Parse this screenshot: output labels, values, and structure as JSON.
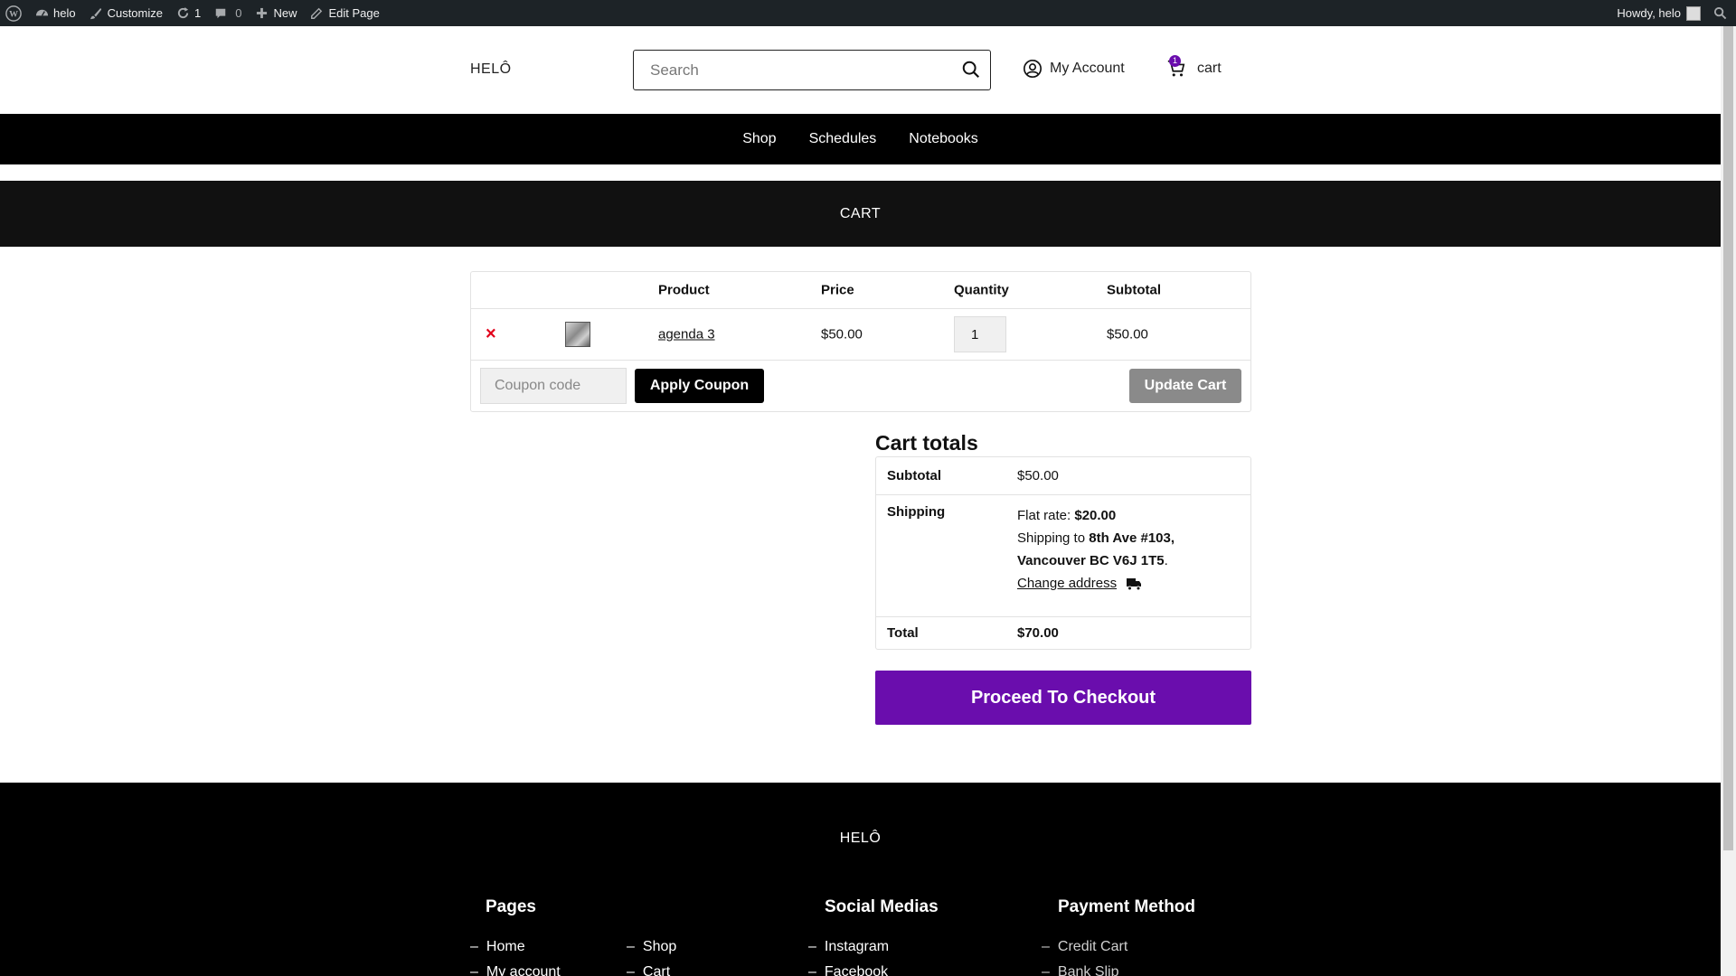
{
  "adminbar": {
    "site_name": "helo",
    "customize": "Customize",
    "updates_count": "1",
    "comments_count": "0",
    "new": "New",
    "edit_page": "Edit Page",
    "howdy": "Howdy, helo"
  },
  "header": {
    "logo": "HELÔ",
    "search_placeholder": "Search",
    "account": "My Account",
    "cart": "cart",
    "cart_count": "1"
  },
  "nav": [
    "Shop",
    "Schedules",
    "Notebooks"
  ],
  "page_title": "CART",
  "cart": {
    "columns": {
      "product": "Product",
      "price": "Price",
      "quantity": "Quantity",
      "subtotal": "Subtotal"
    },
    "items": [
      {
        "remove": "×",
        "name": "agenda 3",
        "price": "$50.00",
        "quantity": "1",
        "subtotal": "$50.00"
      }
    ],
    "coupon_placeholder": "Coupon code",
    "apply_coupon": "Apply Coupon",
    "update_cart": "Update Cart"
  },
  "totals": {
    "title": "Cart totals",
    "subtotal_label": "Subtotal",
    "subtotal_value": "$50.00",
    "shipping_label": "Shipping",
    "flat_rate_label": "Flat rate: ",
    "flat_rate_value": "$20.00",
    "shipping_to_prefix": "Shipping to ",
    "shipping_address_line1": "8th Ave #103,",
    "shipping_address_line2": "Vancouver BC V6J 1T5",
    "change_address": "Change address",
    "total_label": "Total",
    "total_value": "$70.00",
    "checkout": "Proceed To Checkout"
  },
  "footer": {
    "logo": "HELÔ",
    "pages_title": "Pages",
    "pages_col1": [
      "Home",
      "My account"
    ],
    "pages_col2": [
      "Shop",
      "Cart"
    ],
    "social_title": "Social Medias",
    "social": [
      "Instagram",
      "Facebook"
    ],
    "payment_title": "Payment Method",
    "payment": [
      "Credit Cart",
      "Bank Slip"
    ]
  },
  "colors": {
    "accent": "#6a0dad",
    "remove": "#e2001a",
    "adminbar": "#1d2327"
  }
}
